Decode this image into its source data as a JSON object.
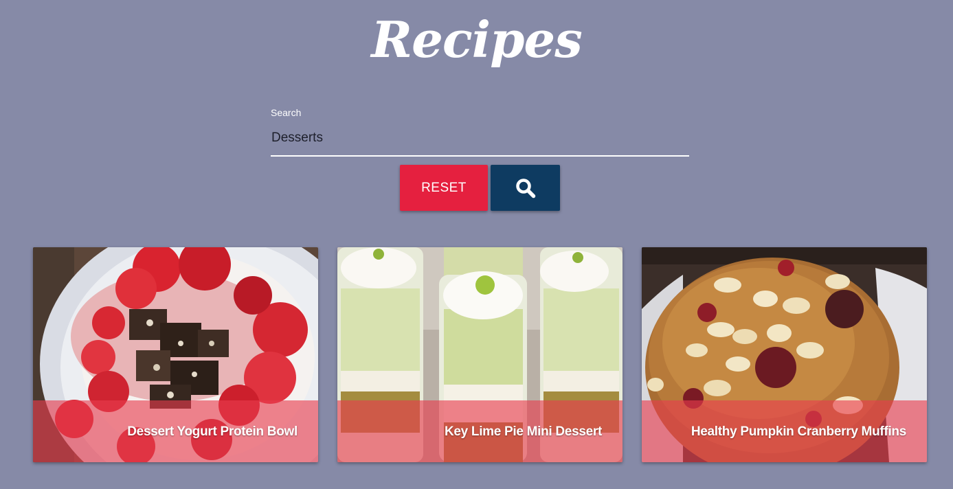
{
  "header": {
    "title": "Recipes"
  },
  "search": {
    "label": "Search",
    "value": "Desserts",
    "placeholder": ""
  },
  "buttons": {
    "reset_label": "RESET",
    "search_icon": "search-icon"
  },
  "colors": {
    "background": "#868aa7",
    "reset": "#e5203f",
    "search": "#0e3b61",
    "caption_overlay": "#e93c4e"
  },
  "recipes": [
    {
      "title": "Dessert Yogurt Protein Bowl",
      "image": "strawberry-yogurt-bowl-photo"
    },
    {
      "title": "Key Lime Pie Mini Dessert",
      "image": "key-lime-pie-glasses-photo"
    },
    {
      "title": "Healthy Pumpkin Cranberry Muffins",
      "image": "pumpkin-cranberry-muffin-photo"
    }
  ]
}
